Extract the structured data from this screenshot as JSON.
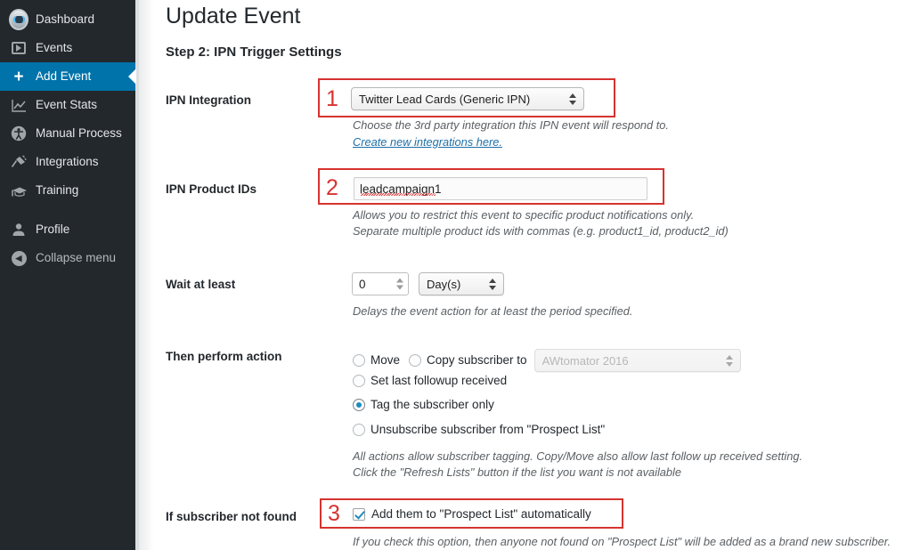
{
  "sidebar": {
    "items": [
      {
        "label": "Dashboard",
        "icon": "robot-logo-icon",
        "active": false,
        "dim": false
      },
      {
        "label": "Events",
        "icon": "video-play-icon",
        "active": false,
        "dim": false
      },
      {
        "label": "Add Event",
        "icon": "plus-icon",
        "active": true,
        "dim": false
      },
      {
        "label": "Event Stats",
        "icon": "chart-line-icon",
        "active": false,
        "dim": false
      },
      {
        "label": "Manual Process",
        "icon": "accessibility-icon",
        "active": false,
        "dim": false
      },
      {
        "label": "Integrations",
        "icon": "plug-icon",
        "active": false,
        "dim": false
      },
      {
        "label": "Training",
        "icon": "graduation-cap-icon",
        "active": false,
        "dim": false
      }
    ],
    "footer_items": [
      {
        "label": "Profile",
        "icon": "user-icon",
        "active": false,
        "dim": false
      },
      {
        "label": "Collapse menu",
        "icon": "collapse-arrow-icon",
        "active": false,
        "dim": true
      }
    ]
  },
  "header": {
    "page_title": "Update Event",
    "step_title": "Step 2: IPN Trigger Settings"
  },
  "form": {
    "ipn_integration": {
      "label": "IPN Integration",
      "selected": "Twitter Lead Cards (Generic IPN)",
      "help": "Choose the 3rd party integration this IPN event will respond to.",
      "link": "Create new integrations here."
    },
    "ipn_product_ids": {
      "label": "IPN Product IDs",
      "value": "leadcampaign1",
      "help_line1": "Allows you to restrict this event to specific product notifications only.",
      "help_line2": "Separate multiple product ids with commas (e.g. product1_id, product2_id)"
    },
    "wait_at_least": {
      "label": "Wait at least",
      "amount": "0",
      "unit": "Day(s)",
      "help": "Delays the event action for at least the period specified."
    },
    "then_perform_action": {
      "label": "Then perform action",
      "move_label": "Move",
      "copy_label": "Copy subscriber to",
      "move_checked": false,
      "copy_checked": false,
      "list_select_value": "AWtomator 2016",
      "list_select_disabled": true,
      "options": [
        {
          "label": "Set last followup received",
          "checked": false
        },
        {
          "label": "Tag the subscriber only",
          "checked": true
        },
        {
          "label": "Unsubscribe subscriber from  \"Prospect List\"",
          "checked": false
        }
      ],
      "help_line1": "All actions allow subscriber tagging. Copy/Move also allow last follow up received setting.",
      "help_line2": "Click the \"Refresh Lists\" button if the list you want is not available"
    },
    "if_subscriber_not_found": {
      "label": "If subscriber not found",
      "checkbox_label": "Add them to \"Prospect List\" automatically",
      "checked": true,
      "help": "If you check this option, then anyone not found on \"Prospect List\" will be added as a brand new subscriber."
    }
  },
  "annotations": {
    "markers": [
      {
        "number": "1",
        "target": "ipn-integration-select"
      },
      {
        "number": "2",
        "target": "ipn-product-ids-input"
      },
      {
        "number": "3",
        "target": "add-to-prospect-list-checkbox"
      }
    ],
    "box_color": "#d6332f"
  },
  "colors": {
    "sidebar_bg": "#23282d",
    "sidebar_active": "#0073aa",
    "accent_blue": "#1e8cbe",
    "link_blue": "#1e6fa8",
    "annotation_red": "#d6332f",
    "text_dark": "#23282d",
    "help_gray": "#5a5f63"
  }
}
